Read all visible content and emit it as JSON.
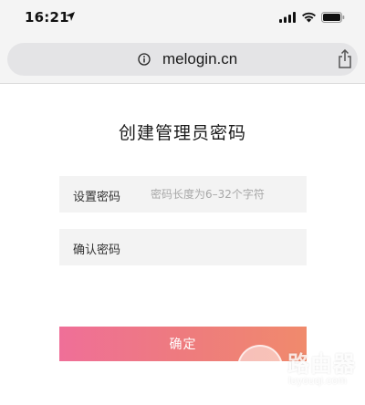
{
  "status_bar": {
    "time": "16:21",
    "icons": [
      "location-arrow-icon",
      "signal-icon",
      "wifi-icon",
      "battery-icon"
    ]
  },
  "browser": {
    "url": "melogin.cn",
    "icons": [
      "info-icon",
      "share-icon"
    ]
  },
  "page": {
    "title": "创建管理员密码",
    "fields": {
      "password": {
        "label": "设置密码",
        "placeholder": "密码长度为6–32个字符",
        "value": ""
      },
      "confirm": {
        "label": "确认密码",
        "placeholder": "",
        "value": ""
      }
    },
    "confirm_button": "确定",
    "colors": {
      "button_gradient_start": "#ef6f98",
      "button_gradient_end": "#f08a6c",
      "field_background": "#f3f3f3",
      "placeholder": "#a8a8a8"
    }
  },
  "watermark": {
    "title": "路由器",
    "subtitle": "luyouqi.com"
  }
}
